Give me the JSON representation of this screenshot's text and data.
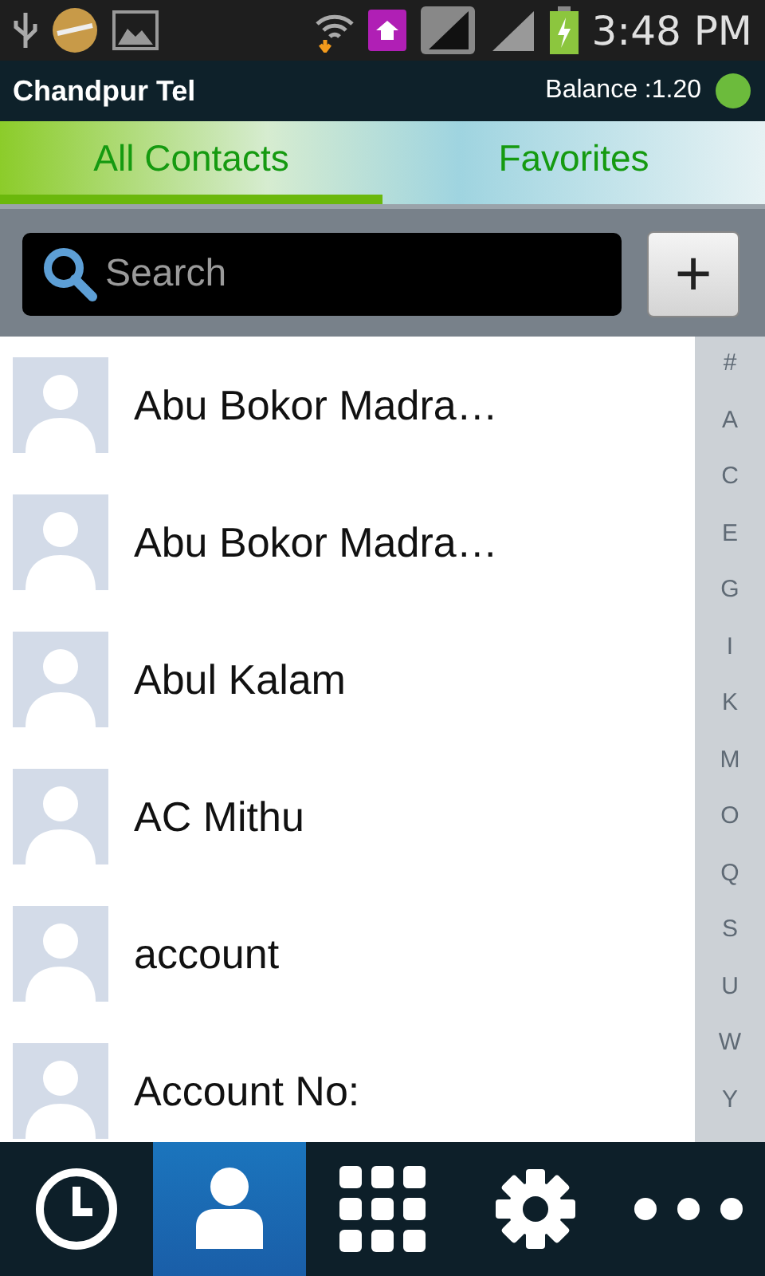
{
  "status_bar": {
    "time": "3:48 PM"
  },
  "header": {
    "title": "Chandpur Tel",
    "balance": "Balance :1.20"
  },
  "tabs": [
    {
      "label": "All Contacts",
      "selected": true
    },
    {
      "label": "Favorites",
      "selected": false
    }
  ],
  "search": {
    "placeholder": "Search"
  },
  "add_button": {
    "label": "+"
  },
  "contacts": [
    {
      "name": "Abu Bokor Madra…"
    },
    {
      "name": "Abu Bokor Madra…"
    },
    {
      "name": "Abul Kalam"
    },
    {
      "name": "AC Mithu"
    },
    {
      "name": "account"
    },
    {
      "name": "Account No:"
    }
  ],
  "index": [
    "#",
    "A",
    "C",
    "E",
    "G",
    "I",
    "K",
    "M",
    "O",
    "Q",
    "S",
    "U",
    "W",
    "Y"
  ],
  "bottom_nav": [
    {
      "kind": "clock",
      "selected": false
    },
    {
      "kind": "person",
      "selected": true
    },
    {
      "kind": "grid",
      "selected": false
    },
    {
      "kind": "gear",
      "selected": false
    },
    {
      "kind": "more",
      "selected": false
    }
  ]
}
